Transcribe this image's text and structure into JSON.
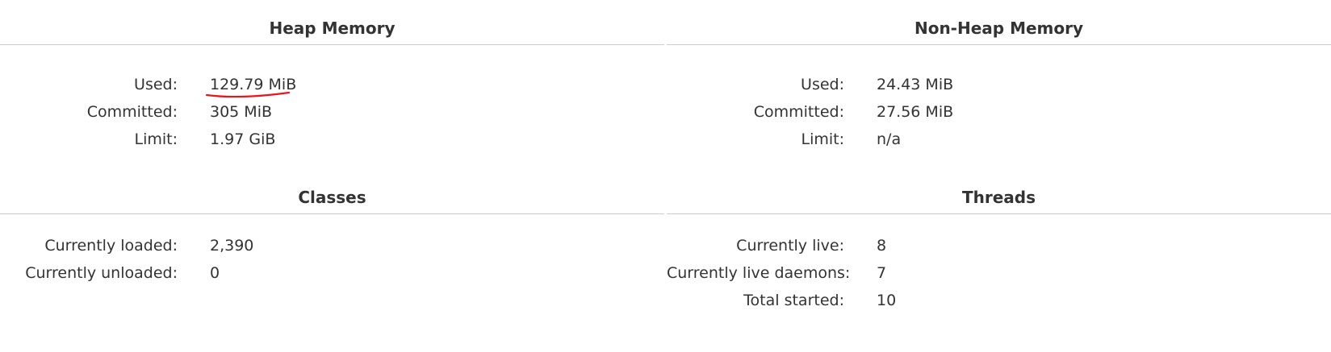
{
  "heap": {
    "title": "Heap Memory",
    "rows": [
      {
        "label": "Used:",
        "value": "129.79 MiB"
      },
      {
        "label": "Committed:",
        "value": "305 MiB"
      },
      {
        "label": "Limit:",
        "value": "1.97 GiB"
      }
    ]
  },
  "non_heap": {
    "title": "Non-Heap Memory",
    "rows": [
      {
        "label": "Used:",
        "value": "24.43 MiB"
      },
      {
        "label": "Committed:",
        "value": "27.56 MiB"
      },
      {
        "label": "Limit:",
        "value": "n/a"
      }
    ]
  },
  "classes": {
    "title": "Classes",
    "rows": [
      {
        "label": "Currently loaded:",
        "value": "2,390"
      },
      {
        "label": "Currently unloaded:",
        "value": "0"
      }
    ]
  },
  "threads": {
    "title": "Threads",
    "rows": [
      {
        "label": "Currently live:",
        "value": "8"
      },
      {
        "label": "Currently live daemons:",
        "value": "7"
      },
      {
        "label": "Total started:",
        "value": "10"
      }
    ]
  },
  "colors": {
    "text": "#333333",
    "divider": "#cccccc",
    "annotation": "#e8141e"
  }
}
